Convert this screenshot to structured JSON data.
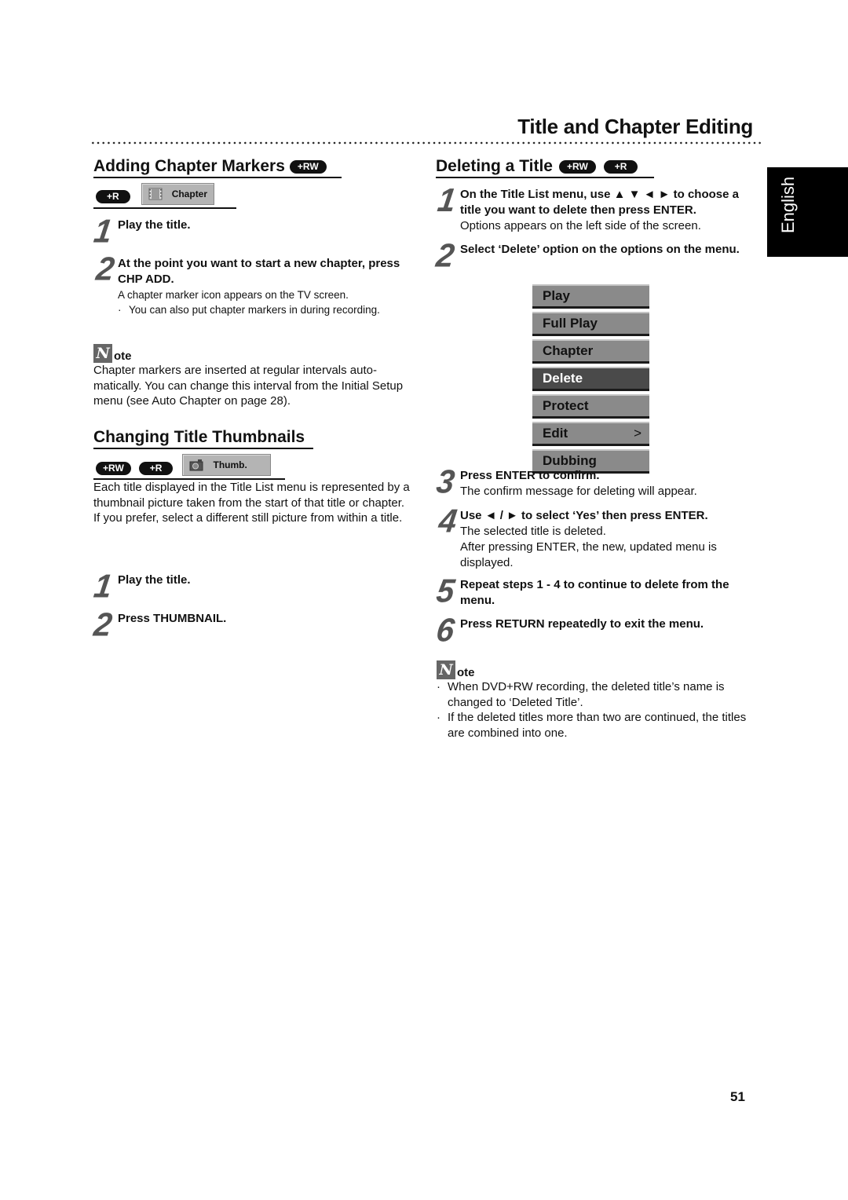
{
  "header": {
    "page_title": "Title and Chapter Editing",
    "language_tab": "English",
    "page_number": "51"
  },
  "left": {
    "adding": {
      "title": "Adding Chapter Markers",
      "title_badges": [
        "+RW"
      ],
      "row_badges": [
        "+R"
      ],
      "osd_button": {
        "icon": "film-chapter-icon",
        "label": "Chapter"
      },
      "steps": [
        {
          "num": "1",
          "bold": "Play the title.",
          "text": []
        },
        {
          "num": "2",
          "bold": "At the point you want to start a new chapter, press CHP ADD.",
          "text": [
            "A chapter marker icon appears on the TV screen."
          ],
          "bullets": [
            "You can also put chapter markers in during recording."
          ]
        }
      ],
      "note": {
        "icon_letter": "N",
        "label": "ote",
        "text": "Chapter markers are inserted at regular intervals auto-matically. You can change this interval from the Initial Setup menu (see Auto Chapter on page 28)."
      }
    },
    "thumbnails": {
      "title": "Changing Title Thumbnails",
      "row_badges": [
        "+RW",
        "+R"
      ],
      "osd_button": {
        "icon": "camera-thumb-icon",
        "label": "Thumb."
      },
      "paragraphs": [
        "Each title displayed in the Title List menu is represented by a thumbnail picture taken from the start of that title or chapter.",
        "If you prefer, select a different still picture from within a title."
      ],
      "steps": [
        {
          "num": "1",
          "bold": "Play the title."
        },
        {
          "num": "2",
          "bold": "Press THUMBNAIL."
        }
      ]
    }
  },
  "right": {
    "deleting": {
      "title": "Deleting a Title",
      "title_badges": [
        "+RW",
        "+R"
      ],
      "steps": [
        {
          "num": "1",
          "bold": "On the Title List menu, use ▲ ▼ ◄ ► to choose a title you want to delete then press ENTER.",
          "text": "Options appears on the left side of the screen."
        },
        {
          "num": "2",
          "bold": "Select ‘Delete’ option on the options on the menu.",
          "text": ""
        },
        {
          "num": "3",
          "bold": "Press ENTER to confirm.",
          "text": "The confirm message for deleting will appear."
        },
        {
          "num": "4",
          "bold": "Use ◄ / ► to select ‘Yes’ then press ENTER.",
          "text": "The selected title is deleted.\nAfter pressing ENTER, the new, updated menu is displayed."
        },
        {
          "num": "5",
          "bold": "Repeat steps 1 - 4 to continue to delete from the menu.",
          "text": ""
        },
        {
          "num": "6",
          "bold": "Press RETURN repeatedly to exit the menu.",
          "text": ""
        }
      ],
      "menu": {
        "items": [
          {
            "label": "Play",
            "selected": false,
            "has_submenu": false
          },
          {
            "label": "Full Play",
            "selected": false,
            "has_submenu": false
          },
          {
            "label": "Chapter",
            "selected": false,
            "has_submenu": false
          },
          {
            "label": "Delete",
            "selected": true,
            "has_submenu": false
          },
          {
            "label": "Protect",
            "selected": false,
            "has_submenu": false
          },
          {
            "label": "Edit",
            "selected": false,
            "has_submenu": true,
            "arrow": ">"
          },
          {
            "label": "Dubbing",
            "selected": false,
            "has_submenu": false
          }
        ]
      },
      "note": {
        "icon_letter": "N",
        "label": "ote",
        "bullets": [
          "When DVD+RW recording, the deleted title’s name is changed to ‘Deleted Title’.",
          "If the deleted titles more than two are continued, the titles are combined into one."
        ]
      }
    }
  }
}
